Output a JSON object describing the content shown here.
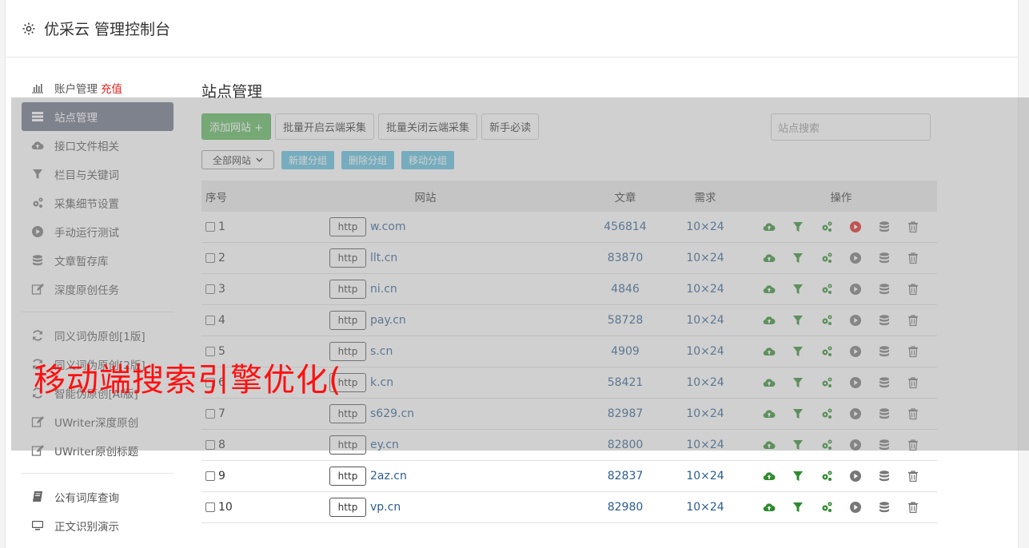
{
  "header": {
    "title": "优采云 管理控制台",
    "icon": "gear-icon"
  },
  "sidebar": {
    "group1": [
      {
        "label": "账户管理",
        "icon": "bar-chart-icon",
        "extra": "充值"
      },
      {
        "label": "站点管理",
        "icon": "list-icon",
        "active": true
      },
      {
        "label": "接口文件相关",
        "icon": "cloud-upload-icon"
      },
      {
        "label": "栏目与关键词",
        "icon": "filter-icon"
      },
      {
        "label": "采集细节设置",
        "icon": "gears-icon"
      },
      {
        "label": "手动运行测试",
        "icon": "play-circle-icon"
      },
      {
        "label": "文章暂存库",
        "icon": "database-icon"
      },
      {
        "label": "深度原创任务",
        "icon": "edit-icon"
      }
    ],
    "group2": [
      {
        "label": "同义词伪原创[1版]",
        "icon": "refresh-icon"
      },
      {
        "label": "同义词伪原创[2版]",
        "icon": "refresh-icon"
      },
      {
        "label": "智能伪原创[AI版]",
        "icon": "refresh-icon"
      },
      {
        "label": "UWriter深度原创",
        "icon": "edit-icon"
      },
      {
        "label": "UWriter原创标题",
        "icon": "edit-icon"
      }
    ],
    "group3": [
      {
        "label": "公有词库查询",
        "icon": "book-icon"
      },
      {
        "label": "正文识别演示",
        "icon": "monitor-icon"
      }
    ]
  },
  "main": {
    "title": "站点管理",
    "toolbar": {
      "add_site": "添加网站 +",
      "batch_open": "批量开启云端采集",
      "batch_close": "批量关闭云端采集",
      "guide": "新手必读"
    },
    "search_placeholder": "站点搜索",
    "group_select": "全部网站",
    "group_buttons": {
      "new": "新建分组",
      "delete": "删除分组",
      "move": "移动分组"
    },
    "table": {
      "headers": {
        "no": "序号",
        "site": "网站",
        "articles": "文章",
        "demand": "需求",
        "ops": "操作"
      },
      "http_label": "http",
      "rows": [
        {
          "no": "1",
          "site": "w.com",
          "articles": "456814",
          "demand": "10×24",
          "running": true
        },
        {
          "no": "2",
          "site": "llt.cn",
          "articles": "83870",
          "demand": "10×24"
        },
        {
          "no": "3",
          "site": "ni.cn",
          "articles": "4846",
          "demand": "10×24"
        },
        {
          "no": "4",
          "site": "pay.cn",
          "articles": "58728",
          "demand": "10×24"
        },
        {
          "no": "5",
          "site": "s.cn",
          "articles": "4909",
          "demand": "10×24"
        },
        {
          "no": "6",
          "site": "k.cn",
          "articles": "58421",
          "demand": "10×24"
        },
        {
          "no": "7",
          "site": "s629.cn",
          "articles": "82987",
          "demand": "10×24"
        },
        {
          "no": "8",
          "site": "ey.cn",
          "articles": "82800",
          "demand": "10×24"
        },
        {
          "no": "9",
          "site": "2az.cn",
          "articles": "82837",
          "demand": "10×24"
        },
        {
          "no": "10",
          "site": "vp.cn",
          "articles": "82980",
          "demand": "10×24"
        }
      ]
    }
  },
  "watermark": "移动端搜索引擎优化(",
  "colors": {
    "green": "#5cb85c",
    "info": "#5bc0de",
    "link": "#2a5d8f",
    "active_bg": "#6b7283",
    "red": "#e0201b",
    "op_green": "#2e8b2e"
  }
}
